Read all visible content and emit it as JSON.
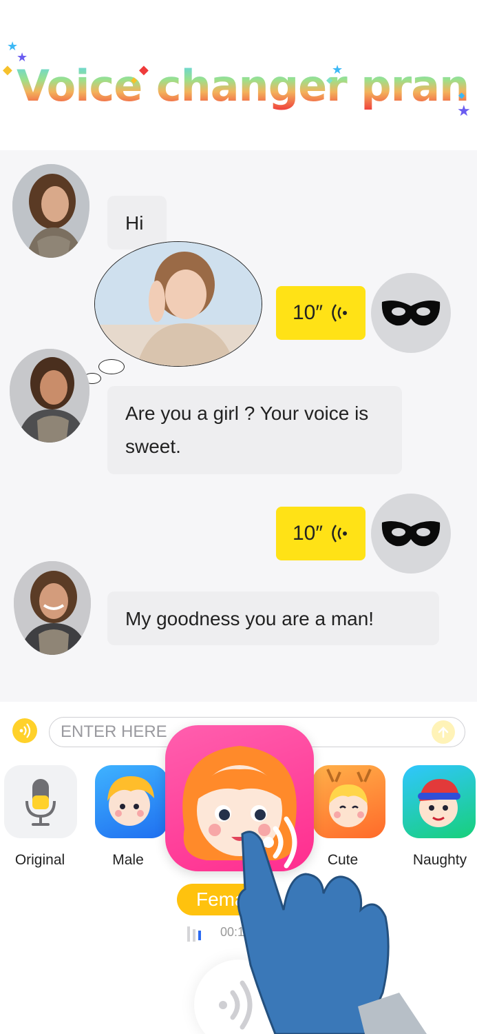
{
  "app": {
    "title": "Voice changer prank"
  },
  "chat": {
    "messages": [
      {
        "side": "left",
        "text": "Hi"
      },
      {
        "side": "right",
        "voice_duration": "10″"
      },
      {
        "side": "left",
        "text": "Are you a girl ? Your voice is sweet."
      },
      {
        "side": "right",
        "voice_duration": "10″"
      },
      {
        "side": "left",
        "text": "My goodness you are a man!"
      }
    ]
  },
  "input": {
    "placeholder": "ENTER HERE"
  },
  "voices": [
    {
      "label": "Original",
      "icon": "microphone-icon"
    },
    {
      "label": "Male",
      "icon": "boy-face-icon"
    },
    {
      "label": "Female",
      "icon": "girl-face-icon",
      "selected": true
    },
    {
      "label": "Cute",
      "icon": "cute-face-icon"
    },
    {
      "label": "Naughty",
      "icon": "naughty-face-icon"
    }
  ],
  "selected_voice": {
    "label": "Female"
  },
  "player": {
    "timer": "00:1"
  },
  "colors": {
    "accent_yellow": "#ffe216",
    "pill_yellow": "#ffc20e",
    "female_pink": "#ff2d8e",
    "chat_background": "#f6f6f8",
    "bubble_grey": "#eeeef0"
  }
}
